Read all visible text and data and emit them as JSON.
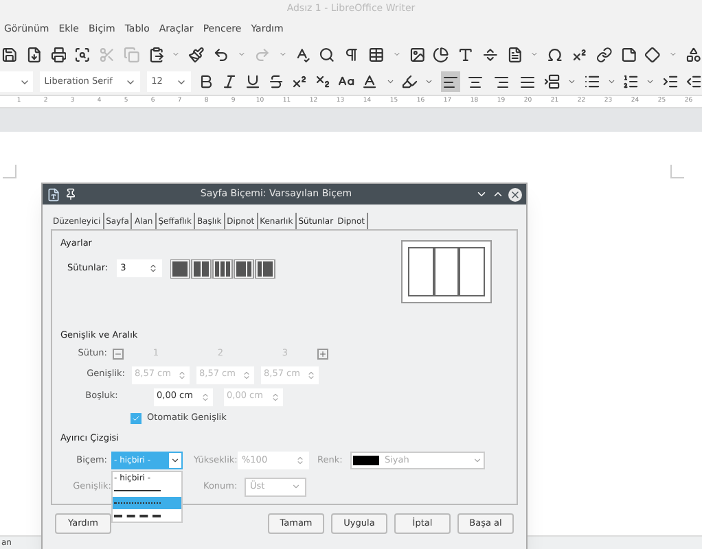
{
  "window": {
    "title": "Adsız 1 - LibreOffice Writer"
  },
  "menu": [
    "Görünüm",
    "Ekle",
    "Biçim",
    "Tablo",
    "Araçlar",
    "Pencere",
    "Yardım"
  ],
  "format_bar": {
    "font_name": "Liberation Serif",
    "font_size": "12"
  },
  "align_buttons": [
    {
      "selected": true
    },
    {
      "selected": false
    },
    {
      "selected": false
    },
    {
      "selected": false
    }
  ],
  "ruler_labels": [
    "1",
    "2",
    "3",
    "4",
    "5",
    "6",
    "7",
    "8",
    "9",
    "10",
    "11",
    "12",
    "13",
    "14",
    "15",
    "16",
    "17",
    "18",
    "19",
    "20",
    "21",
    "22",
    "23",
    "24",
    "25",
    "26"
  ],
  "status_bar": {
    "left": "an"
  },
  "dialog": {
    "title": "Sayfa Biçemi: Varsayılan Biçem",
    "tabs": [
      {
        "label": "Düzenleyici",
        "selected": false
      },
      {
        "label": "Sayfa",
        "selected": false
      },
      {
        "label": "Alan",
        "selected": false
      },
      {
        "label": "Şeffaflık",
        "selected": false
      },
      {
        "label": "Başlık",
        "selected": false
      },
      {
        "label": "Dipnot",
        "selected": false
      },
      {
        "label": "Kenarlık",
        "selected": false
      },
      {
        "label": "Sütunlar",
        "selected": true
      },
      {
        "label": "Dipnot",
        "selected": false
      }
    ],
    "settings": {
      "heading": "Ayarlar",
      "columns_label": "Sütunlar:",
      "columns_value": "3"
    },
    "width_spacing": {
      "heading": "Genişlik ve Aralık",
      "column_label": "Sütun:",
      "column_numbers": [
        "1",
        "2",
        "3"
      ],
      "width_label": "Genişlik:",
      "widths": [
        "8,57 cm",
        "8,57 cm",
        "8,57 cm"
      ],
      "spacing_label": "Boşluk:",
      "spacings": [
        {
          "value": "0,00 cm",
          "disabled": false
        },
        {
          "value": "0,00 cm",
          "disabled": true
        }
      ],
      "auto_width": {
        "label": "Otomatik Genişlik",
        "checked": true
      }
    },
    "separator": {
      "heading": "Ayırıcı Çizgisi",
      "style_label": "Biçem:",
      "style_value": "- hiçbiri -",
      "height_label": "Yükseklik:",
      "height_value": "%100",
      "color_label": "Renk:",
      "color_name": "Siyah",
      "color": "#000000",
      "width_label": "Genişlik:",
      "position_label": "Konum:",
      "position_value": "Üst",
      "style_options": [
        {
          "kind": "text",
          "label": "- hiçbiri -",
          "selected": false
        },
        {
          "kind": "solid",
          "selected": false
        },
        {
          "kind": "dotted",
          "selected": true
        },
        {
          "kind": "dashed",
          "selected": false
        }
      ]
    },
    "buttons": [
      {
        "label": "Yardım"
      },
      {
        "label": "Tamam"
      },
      {
        "label": "Uygula"
      },
      {
        "label": "İptal"
      },
      {
        "label": "Başa al"
      }
    ]
  }
}
